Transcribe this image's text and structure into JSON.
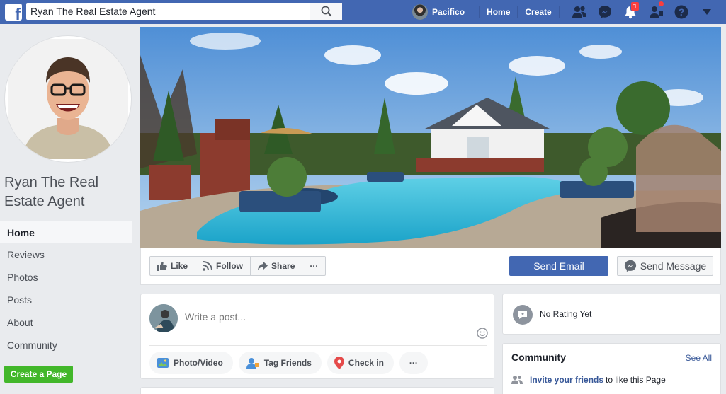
{
  "header": {
    "search_value": "Ryan The Real Estate Agent",
    "user_name": "Pacifico",
    "home_label": "Home",
    "create_label": "Create",
    "notification_count": "1",
    "brand_color": "#4267b2"
  },
  "page": {
    "name": "Ryan The Real Estate Agent"
  },
  "sidebar": {
    "items": [
      {
        "label": "Home"
      },
      {
        "label": "Reviews"
      },
      {
        "label": "Photos"
      },
      {
        "label": "Posts"
      },
      {
        "label": "About"
      },
      {
        "label": "Community"
      }
    ],
    "create_page_label": "Create a Page"
  },
  "actions": {
    "like_label": "Like",
    "follow_label": "Follow",
    "share_label": "Share",
    "more_label": "···",
    "send_email_label": "Send Email",
    "send_message_label": "Send Message"
  },
  "composer": {
    "placeholder": "Write a post...",
    "photo_video_label": "Photo/Video",
    "tag_friends_label": "Tag Friends",
    "check_in_label": "Check in",
    "more_label": "···"
  },
  "rating": {
    "text": "No Rating Yet"
  },
  "community": {
    "title": "Community",
    "see_all_label": "See All",
    "invite_link": "Invite your friends",
    "invite_rest": "to like this Page"
  },
  "icons": [
    "facebook-logo-icon",
    "search-icon",
    "friends-icon",
    "messenger-icon",
    "bell-icon",
    "friend-requests-icon",
    "help-icon",
    "caret-down-icon",
    "like-icon",
    "rss-icon",
    "share-icon",
    "messenger-icon",
    "smiley-icon",
    "photo-icon",
    "tag-icon",
    "location-pin-icon",
    "review-icon",
    "people-icon"
  ]
}
